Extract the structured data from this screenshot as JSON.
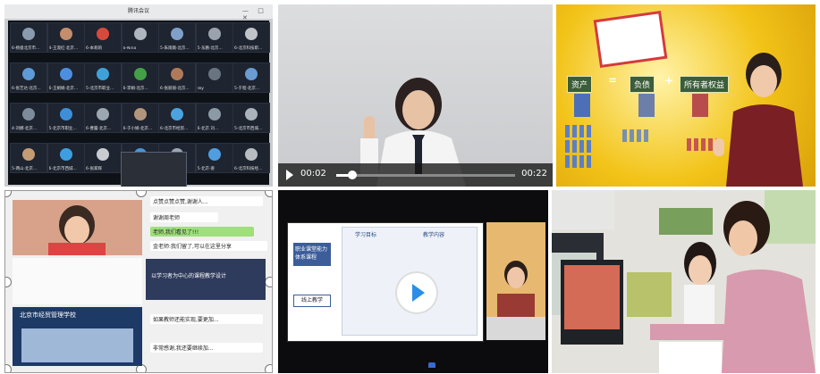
{
  "meeting": {
    "window_title": "腾讯会议",
    "window_controls": "— □ ✕",
    "tiles": [
      {
        "name": "6-杨俊北京市...",
        "color": "#8a9bb0"
      },
      {
        "name": "4-王淑红·北京...",
        "color": "#c48d6b"
      },
      {
        "name": "6-本莉莉",
        "color": "#d64a3c"
      },
      {
        "name": "6-Nina",
        "color": "#b0b6bf"
      },
      {
        "name": "5-朱雨薇·北京...",
        "color": "#7ea0c8"
      },
      {
        "name": "5-东鹏·北京...",
        "color": "#9aa3ad"
      },
      {
        "name": "6-北京科技职...",
        "color": "#c0c4c8"
      },
      {
        "name": "6-张艺达·北京...",
        "color": "#5d9ad6"
      },
      {
        "name": "6-王娟娟·北京...",
        "color": "#4c8fe0"
      },
      {
        "name": "5-北京市职业...",
        "color": "#3fa0d9"
      },
      {
        "name": "6-李娟·北京...",
        "color": "#43a047"
      },
      {
        "name": "6-张丽丽·北京...",
        "color": "#b07a5a"
      },
      {
        "name": "sky",
        "color": "#6a7480"
      },
      {
        "name": "5-于程·北京...",
        "color": "#6a9bd1"
      },
      {
        "name": "4-刘娜·北京...",
        "color": "#7c8c9c"
      },
      {
        "name": "5-北京市职业...",
        "color": "#3d8fd8"
      },
      {
        "name": "6-曹露·北京...",
        "color": "#9da7b2"
      },
      {
        "name": "6-于小娟·北京...",
        "color": "#b2967c"
      },
      {
        "name": "6-北京市经贸...",
        "color": "#4aa3df"
      },
      {
        "name": "6-北京 刘...",
        "color": "#8c9aa6"
      },
      {
        "name": "5-北京市西城...",
        "color": "#aab2bb"
      },
      {
        "name": "5-两山·北京...",
        "color": "#c49c74"
      },
      {
        "name": "6-北京市西城...",
        "color": "#3e9fe0"
      },
      {
        "name": "6-张家辉",
        "color": "#c8ccd0"
      },
      {
        "name": "6-北京市职业...",
        "color": "#4497dc"
      },
      {
        "name": "5-马山姿",
        "color": "#9aa6b2"
      },
      {
        "name": "5-北京·姿",
        "color": "#4f9ee0"
      },
      {
        "name": "6-北京科技经...",
        "color": "#b7bcc2"
      }
    ]
  },
  "video": {
    "current_time": "00:02",
    "duration": "00:22",
    "progress": 0.09
  },
  "accounting": {
    "labels": [
      "资产",
      "负债",
      "所有者权益"
    ],
    "operators": [
      "=",
      "+"
    ]
  },
  "chat": {
    "messages": [
      "点赞点赞点赞,谢谢人...",
      "谢谢周老师",
      "老师,我们看见了!!!",
      "金老师:我们留了,可以在这里分享",
      "北京市经贸管理学校",
      "如果教师还能实现,要更加...",
      "非常感谢,我还要继续加..."
    ],
    "slide_title": "以学习者为中心的课程教学设计"
  },
  "slide": {
    "box1": "职业课堂能力体系课程",
    "box2": "线上教学",
    "col1": "学习目标",
    "col2": "教学内容"
  }
}
